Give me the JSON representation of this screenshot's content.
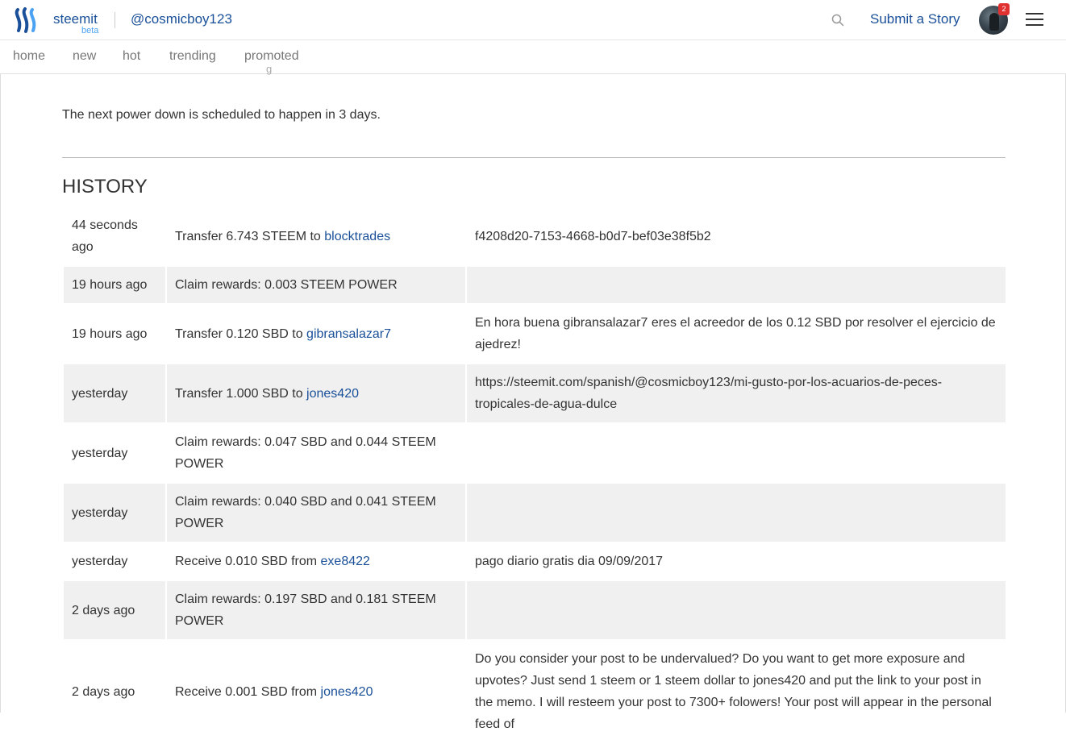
{
  "header": {
    "brand": "steemit",
    "beta": "beta",
    "username": "@cosmicboy123",
    "submit_label": "Submit a Story",
    "notification_count": "2",
    "brand_color": "#1a5099"
  },
  "nav": {
    "tabs": [
      "home",
      "new",
      "hot",
      "trending",
      "promoted"
    ]
  },
  "clipped_text": "g",
  "power_down_text": "The next power down is scheduled to happen  in 3 days.",
  "history": {
    "title": "HISTORY",
    "rows": [
      {
        "time": "44 seconds ago",
        "action": "Transfer 6.743 STEEM to ",
        "account": "blocktrades",
        "memo": "f4208d20-7153-4668-b0d7-bef03e38f5b2"
      },
      {
        "time": "19 hours ago",
        "action": "Claim rewards: 0.003 STEEM POWER",
        "account": "",
        "memo": ""
      },
      {
        "time": "19 hours ago",
        "action": "Transfer 0.120 SBD to ",
        "account": "gibransalazar7",
        "memo": "En hora buena gibransalazar7 eres el acreedor de los 0.12 SBD por resolver el ejercicio de ajedrez!"
      },
      {
        "time": "yesterday",
        "action": "Transfer 1.000 SBD to ",
        "account": "jones420",
        "memo": "https://steemit.com/spanish/@cosmicboy123/mi-gusto-por-los-acuarios-de-peces-tropicales-de-agua-dulce"
      },
      {
        "time": "yesterday",
        "action": "Claim rewards: 0.047 SBD and 0.044 STEEM POWER",
        "account": "",
        "memo": ""
      },
      {
        "time": "yesterday",
        "action": "Claim rewards: 0.040 SBD and 0.041 STEEM POWER",
        "account": "",
        "memo": ""
      },
      {
        "time": "yesterday",
        "action": "Receive 0.010 SBD from ",
        "account": "exe8422",
        "memo": "pago diario gratis dia 09/09/2017"
      },
      {
        "time": "2 days ago",
        "action": "Claim rewards: 0.197 SBD and 0.181 STEEM POWER",
        "account": "",
        "memo": ""
      },
      {
        "time": "2 days ago",
        "action": "Receive 0.001 SBD from ",
        "account": "jones420",
        "memo": "Do you consider your post to be undervalued? Do you want to get more exposure and upvotes? Just send 1 steem or 1 steem dollar to jones420 and put the link to your post in the memo. I will resteem your post to 7300+ folowers! Your post will appear in the personal feed of"
      }
    ]
  }
}
